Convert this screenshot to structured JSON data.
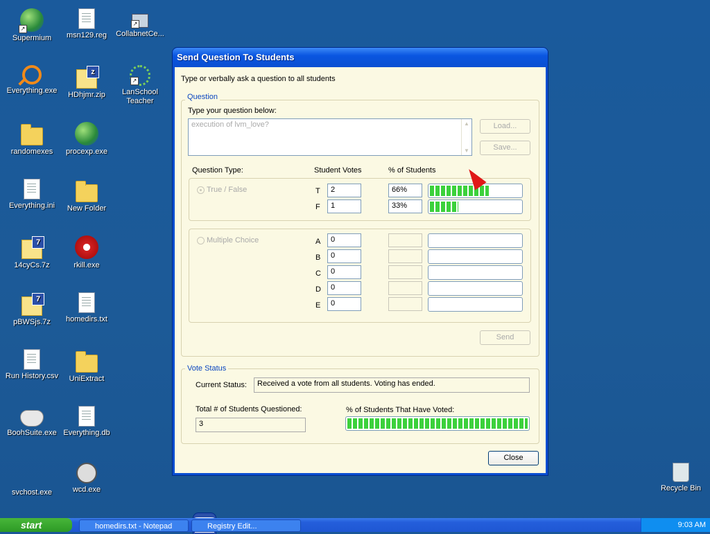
{
  "desktop": {
    "icons": [
      {
        "label": "Supermium",
        "icon": "browser-icon"
      },
      {
        "label": "msn129.reg",
        "icon": "registry-icon"
      },
      {
        "label": "CollabnetCe...",
        "icon": "network-computer-icon"
      },
      {
        "label": "Everything.exe",
        "icon": "magnifier-icon"
      },
      {
        "label": "HDhjmr.zip",
        "icon": "zip-icon"
      },
      {
        "label": "LanSchool Teacher",
        "icon": "lanschool-icon"
      },
      {
        "label": "randomexes",
        "icon": "folder-icon"
      },
      {
        "label": "procexp.exe",
        "icon": "process-explorer-icon"
      },
      {
        "label": "Everything.ini",
        "icon": "settings-file-icon"
      },
      {
        "label": "New Folder",
        "icon": "folder-icon"
      },
      {
        "label": "14cyCs.7z",
        "icon": "7z-archive-icon"
      },
      {
        "label": "rkill.exe",
        "icon": "rkill-icon"
      },
      {
        "label": "pBWSjs.7z",
        "icon": "7z-archive-icon"
      },
      {
        "label": "homedirs.txt",
        "icon": "text-file-icon"
      },
      {
        "label": "Run History.csv",
        "icon": "text-file-icon"
      },
      {
        "label": "UniExtract",
        "icon": "folder-icon"
      },
      {
        "label": "BoohSuite.exe",
        "icon": "gamepad-icon"
      },
      {
        "label": "Everything.db",
        "icon": "db-file-icon"
      },
      {
        "label": "svchost.exe",
        "icon": "window-app-icon"
      },
      {
        "label": "wcd.exe",
        "icon": "film-reel-icon"
      },
      {
        "label": "Recycle Bin",
        "icon": "recycle-bin-icon"
      }
    ]
  },
  "dialog": {
    "title": "Send Question To Students",
    "intro": "Type or verbally ask a question to all students",
    "question_group": {
      "title": "Question",
      "prompt_label": "Type your question below:",
      "question_text": "execution of lvm_love?",
      "load_label": "Load...",
      "save_label": "Save..."
    },
    "columns": {
      "question_type": "Question Type:",
      "student_votes": "Student Votes",
      "percent_students": "% of Students"
    },
    "true_false": {
      "label": "True / False",
      "selected": true,
      "rows": [
        {
          "letter": "T",
          "votes": "2",
          "percent": "66%",
          "fill": 0.66
        },
        {
          "letter": "F",
          "votes": "1",
          "percent": "33%",
          "fill": 0.33
        }
      ]
    },
    "multiple_choice": {
      "label": "Multiple Choice",
      "selected": false,
      "rows": [
        {
          "letter": "A",
          "votes": "0",
          "percent": "",
          "fill": 0
        },
        {
          "letter": "B",
          "votes": "0",
          "percent": "",
          "fill": 0
        },
        {
          "letter": "C",
          "votes": "0",
          "percent": "",
          "fill": 0
        },
        {
          "letter": "D",
          "votes": "0",
          "percent": "",
          "fill": 0
        },
        {
          "letter": "E",
          "votes": "0",
          "percent": "",
          "fill": 0
        }
      ]
    },
    "send_label": "Send",
    "vote_status": {
      "title": "Vote Status",
      "current_status_label": "Current Status:",
      "current_status": "Received a vote from all students. Voting has ended.",
      "total_label": "Total # of Students Questioned:",
      "total_value": "3",
      "voted_label": "% of  Students That Have Voted:",
      "voted_fill": 1.0
    },
    "close_label": "Close"
  },
  "taskbar": {
    "start_label": "start",
    "items": [
      "homedirs.txt - Notepad",
      "Registry Edit..."
    ],
    "clock": "9:03 AM"
  },
  "colors": {
    "desktop": "#1b5798",
    "titlebar": "#0a4fd2",
    "dialog_bg": "#fbf9e3",
    "progress": "#3cd13c",
    "group_title": "#0b46c0"
  }
}
